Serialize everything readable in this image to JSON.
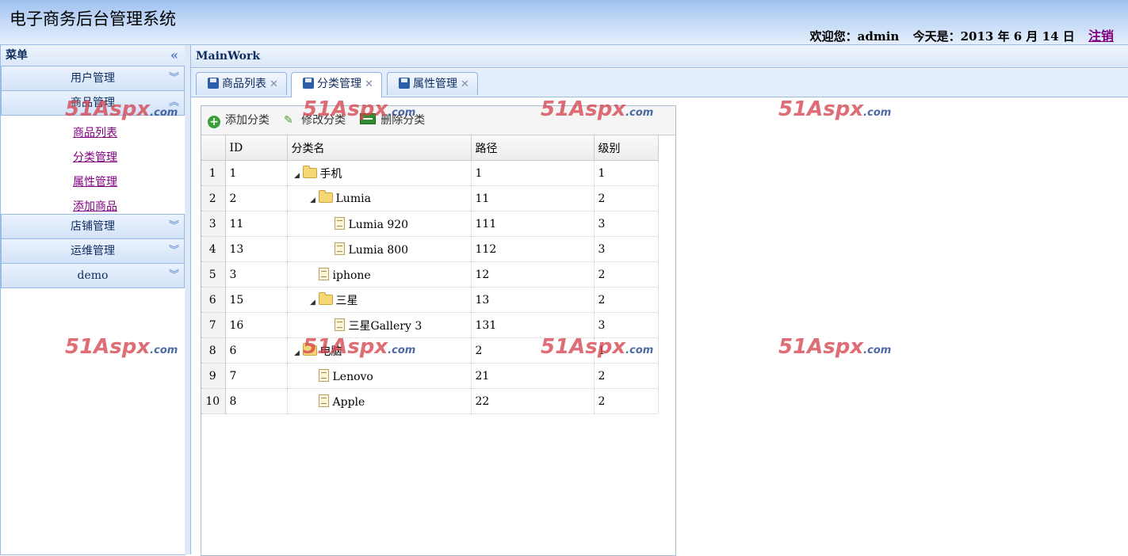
{
  "header": {
    "title": "电子商务后台管理系统",
    "welcome": "欢迎您：admin",
    "today": "今天是：2013 年 6 月 14 日",
    "logout": "注销"
  },
  "menu": {
    "title": "菜单",
    "sections": [
      {
        "label": "用户管理"
      },
      {
        "label": "商品管理",
        "items": [
          "商品列表",
          "分类管理",
          "属性管理",
          "添加商品"
        ]
      },
      {
        "label": "店铺管理"
      },
      {
        "label": "运维管理"
      },
      {
        "label": "demo"
      }
    ]
  },
  "main": {
    "title": "MainWork",
    "tabs": [
      {
        "label": "商品列表"
      },
      {
        "label": "分类管理"
      },
      {
        "label": "属性管理"
      }
    ]
  },
  "toolbar": {
    "add": "添加分类",
    "edit": "修改分类",
    "delete": "删除分类"
  },
  "grid": {
    "columns": [
      "ID",
      "分类名",
      "路径",
      "级别"
    ],
    "rows": [
      {
        "num": "1",
        "id": "1",
        "name": "手机",
        "path": "1",
        "level": "1",
        "depth": 0,
        "type": "folder"
      },
      {
        "num": "2",
        "id": "2",
        "name": "Lumia",
        "path": "11",
        "level": "2",
        "depth": 1,
        "type": "folder"
      },
      {
        "num": "3",
        "id": "11",
        "name": "Lumia 920",
        "path": "111",
        "level": "3",
        "depth": 2,
        "type": "file"
      },
      {
        "num": "4",
        "id": "13",
        "name": "Lumia 800",
        "path": "112",
        "level": "3",
        "depth": 2,
        "type": "file"
      },
      {
        "num": "5",
        "id": "3",
        "name": "iphone",
        "path": "12",
        "level": "2",
        "depth": 1,
        "type": "file"
      },
      {
        "num": "6",
        "id": "15",
        "name": "三星",
        "path": "13",
        "level": "2",
        "depth": 1,
        "type": "folder"
      },
      {
        "num": "7",
        "id": "16",
        "name": "三星Gallery 3",
        "path": "131",
        "level": "3",
        "depth": 2,
        "type": "file"
      },
      {
        "num": "8",
        "id": "6",
        "name": "电脑",
        "path": "2",
        "level": "1",
        "depth": 0,
        "type": "folder"
      },
      {
        "num": "9",
        "id": "7",
        "name": "Lenovo",
        "path": "21",
        "level": "2",
        "depth": 1,
        "type": "file"
      },
      {
        "num": "10",
        "id": "8",
        "name": "Apple",
        "path": "22",
        "level": "2",
        "depth": 1,
        "type": "file"
      }
    ]
  },
  "watermark": {
    "a": "51Aspx",
    "b": ".com"
  }
}
